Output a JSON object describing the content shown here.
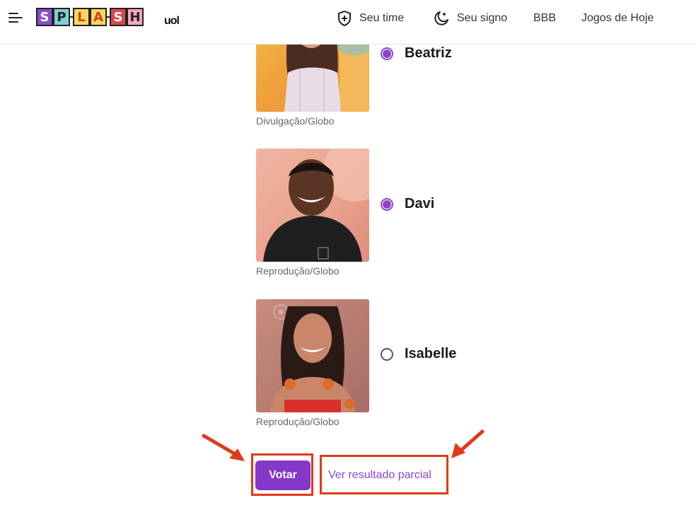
{
  "header": {
    "logo_letters": [
      "S",
      "P",
      "L",
      "A",
      "S",
      "H"
    ],
    "uol": "uol",
    "nav": [
      {
        "label": "Seu time",
        "icon": "shield-plus-icon"
      },
      {
        "label": "Seu signo",
        "icon": "moon-stars-icon"
      },
      {
        "label": "BBB"
      },
      {
        "label": "Jogos de Hoje"
      }
    ]
  },
  "candidates": [
    {
      "name": "Beatriz",
      "credit": "Divulgação/Globo",
      "selected": true
    },
    {
      "name": "Davi",
      "credit": "Reprodução/Globo",
      "selected": true
    },
    {
      "name": "Isabelle",
      "credit": "Reprodução/Globo",
      "selected": false
    }
  ],
  "actions": {
    "vote_label": "Votar",
    "partial_result_label": "Ver resultado parcial"
  },
  "colors": {
    "accent": "#8437c9",
    "annotation": "#e03a1a"
  }
}
